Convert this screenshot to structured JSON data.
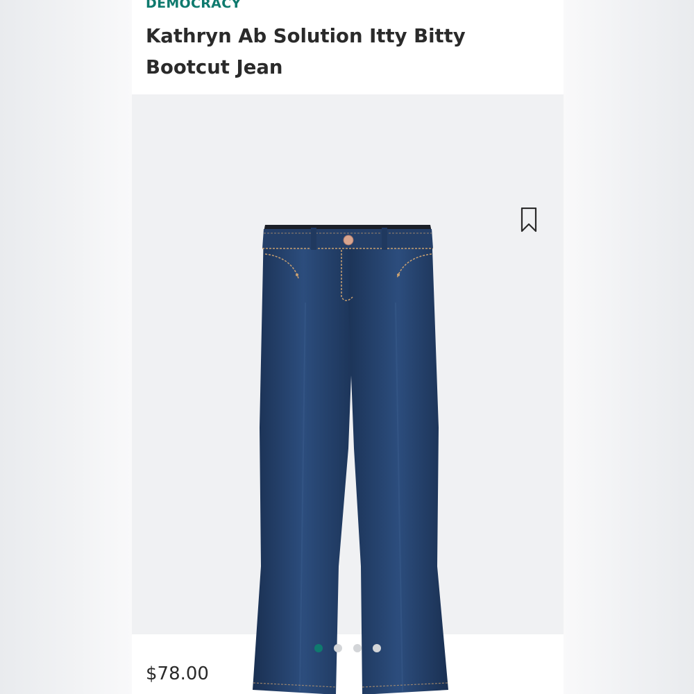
{
  "product": {
    "brand": "DEMOCRACY",
    "title": "Kathryn Ab Solution Itty Bitty Bootcut Jean",
    "price": "$78.00",
    "image_alt": "Kathryn Ab Solution Itty Bitty Bootcut Jean",
    "saved": false
  },
  "gallery": {
    "image_count": 4,
    "active_index": 0
  },
  "colors": {
    "accent": "#0f7a6e",
    "denim": "#1e3a64"
  },
  "icons": {
    "bookmark": "bookmark-icon"
  }
}
